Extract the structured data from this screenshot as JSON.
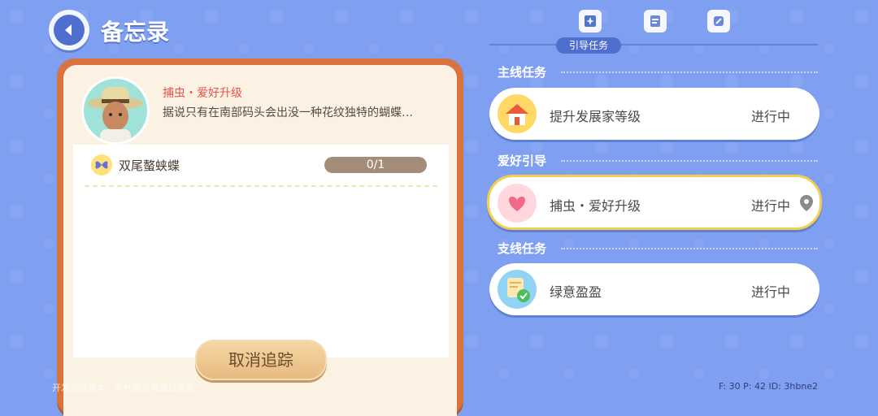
{
  "header": {
    "title": "备忘录"
  },
  "left_card": {
    "quest_title": "捕虫・爱好升级",
    "quest_desc": "据说只有在南部码头会出没一种花纹独特的蝴蝶…",
    "target": {
      "name": "双尾螯蛱蝶",
      "progress": "0/1"
    },
    "cancel_label": "取消追踪"
  },
  "tabs": {
    "active_label": "引导任务"
  },
  "sections": [
    {
      "header": "主线任务",
      "quest": {
        "name": "提升发展家等级",
        "status": "进行中",
        "icon": "house-icon"
      }
    },
    {
      "header": "爱好引导",
      "quest": {
        "name": "捕虫・爱好升级",
        "status": "进行中",
        "icon": "heart-bubble-icon"
      }
    },
    {
      "header": "支线任务",
      "quest": {
        "name": "绿意盈盈",
        "status": "进行中",
        "icon": "note-check-icon"
      }
    }
  ],
  "footer": {
    "watermark": "开发测试版本，不代表游戏最终品质",
    "stats": "F: 30    P: 42    ID: 3hbne2"
  },
  "colors": {
    "background": "#7f9ff0",
    "card_border": "#d9733e",
    "selected_outline": "#f4cf4f",
    "accent_blue": "#4f6fcf"
  }
}
